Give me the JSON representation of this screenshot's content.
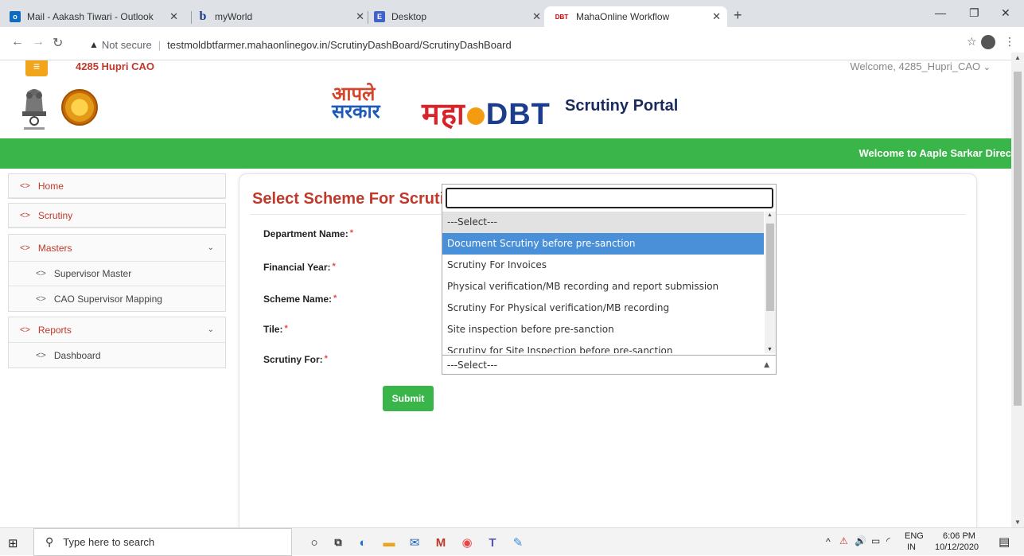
{
  "browser": {
    "tabs": [
      {
        "label": "Mail - Aakash Tiwari - Outlook",
        "icon": "outlook-icon"
      },
      {
        "label": "myWorld",
        "icon": "b-icon"
      },
      {
        "label": "Desktop",
        "icon": "e-icon"
      },
      {
        "label": "MahaOnline Workflow",
        "icon": "dbt-icon",
        "favicon_text": "DBT"
      }
    ],
    "security_label": "Not secure",
    "url": "testmoldbtfarmer.mahaonlinegov.in/ScrutinyDashBoard/ScrutinyDashBoard"
  },
  "header": {
    "office_name": "4285 Hupri CAO",
    "welcome_user": "Welcome, 4285_Hupri_CAO",
    "aaple_line1": "आपले",
    "aaple_line2": "सरकार",
    "mahadbt_prefix": "महा",
    "mahadbt_suffix": "DBT",
    "portal_title": "Scrutiny Portal",
    "marquee": "Welcome to Aaple Sarkar Direc"
  },
  "sidebar": {
    "home": "Home",
    "scrutiny": "Scrutiny",
    "masters": "Masters",
    "masters_items": [
      "Supervisor Master",
      "CAO Supervisor Mapping"
    ],
    "reports": "Reports",
    "reports_items": [
      "Dashboard"
    ]
  },
  "form": {
    "title": "Select Scheme For Scrutiny",
    "department_label": "Department Name:",
    "financial_year_label": "Financial Year:",
    "scheme_label": "Scheme Name:",
    "tile_label": "Tile:",
    "scrutiny_for_label": "Scrutiny For:",
    "required_mark": "*",
    "submit": "Submit"
  },
  "dropdown": {
    "search_value": "",
    "options": [
      "---Select---",
      "Document Scrutiny before pre-sanction",
      "Scrutiny For Invoices",
      "Physical verification/MB recording and report submission",
      "Scrutiny For Physical verification/MB recording",
      "Site inspection before pre-sanction",
      "Scrutiny for Site Inspection before pre-sanction"
    ],
    "selected_index": 0,
    "highlighted_index": 1,
    "closed_value": "---Select---"
  },
  "taskbar": {
    "search_placeholder": "Type here to search",
    "lang": "ENG",
    "region": "IN",
    "time": "6:06 PM",
    "date": "10/12/2020"
  },
  "colors": {
    "accent_red": "#c0392b",
    "green": "#3ab54a",
    "highlight_blue": "#4a90d9"
  }
}
